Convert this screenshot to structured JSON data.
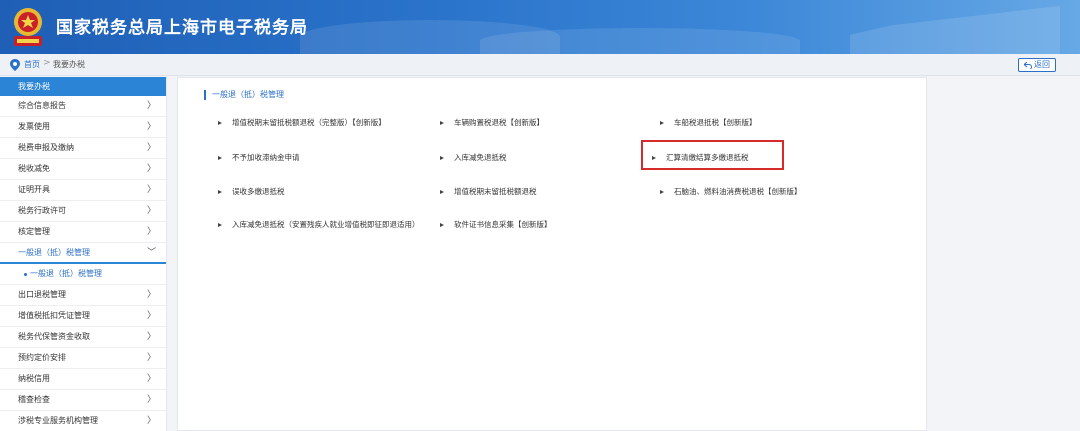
{
  "header": {
    "title": "国家税务总局上海市电子税务局",
    "colors": {
      "bar": "#2a73cb",
      "accent": "#2b84d6"
    }
  },
  "breadcrumb": {
    "home": "首页",
    "separator": ">",
    "current": "我要办税",
    "back_label": "返回"
  },
  "sidebar": {
    "header": "我要办税",
    "items": [
      {
        "label": "综合信息报告",
        "chev": "〉"
      },
      {
        "label": "发票使用",
        "chev": "〉"
      },
      {
        "label": "税费申报及缴纳",
        "chev": "〉"
      },
      {
        "label": "税收减免",
        "chev": "〉"
      },
      {
        "label": "证明开具",
        "chev": "〉"
      },
      {
        "label": "税务行政许可",
        "chev": "〉"
      },
      {
        "label": "核定管理",
        "chev": "〉"
      },
      {
        "label": "一般退（抵）税管理",
        "chev": "﹀",
        "active": true
      },
      {
        "label": "一般退（抵）税管理",
        "sub": true
      },
      {
        "label": "出口退税管理",
        "chev": "〉"
      },
      {
        "label": "增值税抵扣凭证管理",
        "chev": "〉"
      },
      {
        "label": "税务代保管资金收取",
        "chev": "〉"
      },
      {
        "label": "预约定价安排",
        "chev": "〉"
      },
      {
        "label": "纳税信用",
        "chev": "〉"
      },
      {
        "label": "稽查检查",
        "chev": "〉"
      },
      {
        "label": "涉税专业服务机构管理",
        "chev": "〉"
      }
    ]
  },
  "main": {
    "section_title": "一般退（抵）税管理",
    "links": [
      "增值税期末留抵税额退税（完整版）【创新版】",
      "车辆购置税退税【创新版】",
      "车船税退抵税【创新版】",
      "不予加收滞纳金申请",
      "入库减免退抵税",
      "汇算清缴结算多缴退抵税",
      "误收多缴退抵税",
      "增值税期末留抵税额退税",
      "石脑油、燃料油消费税退税【创新版】",
      "入库减免退抵税（安置残疾人就业增值税即征即退适用）",
      "软件证书信息采集【创新版】"
    ],
    "highlight_color": "#d62a2a"
  }
}
